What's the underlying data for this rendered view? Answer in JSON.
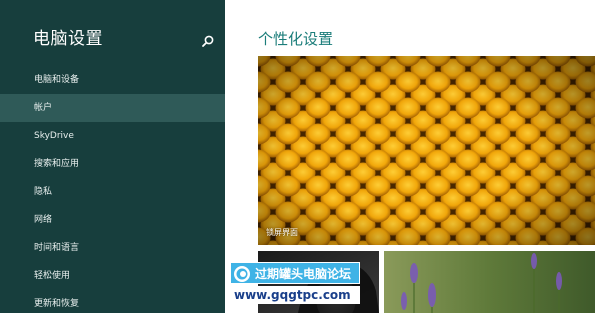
{
  "sidebar": {
    "title": "电脑设置",
    "search_icon": "search-icon",
    "items": [
      {
        "label": "电脑和设备",
        "selected": false
      },
      {
        "label": "帐户",
        "selected": true
      },
      {
        "label": "SkyDrive",
        "selected": false
      },
      {
        "label": "搜索和应用",
        "selected": false
      },
      {
        "label": "隐私",
        "selected": false
      },
      {
        "label": "网络",
        "selected": false
      },
      {
        "label": "时间和语言",
        "selected": false
      },
      {
        "label": "轻松使用",
        "selected": false
      },
      {
        "label": "更新和恢复",
        "selected": false
      }
    ]
  },
  "main": {
    "title": "个性化设置",
    "lockscreen_label": "锁屏界面"
  },
  "watermark": {
    "text": "过期罐头电脑论坛",
    "url": "www.gqgtpc.com"
  },
  "colors": {
    "sidebar_bg": "#173e3d",
    "selected_bg": "#2f5a58",
    "accent": "#1b7d7a"
  }
}
